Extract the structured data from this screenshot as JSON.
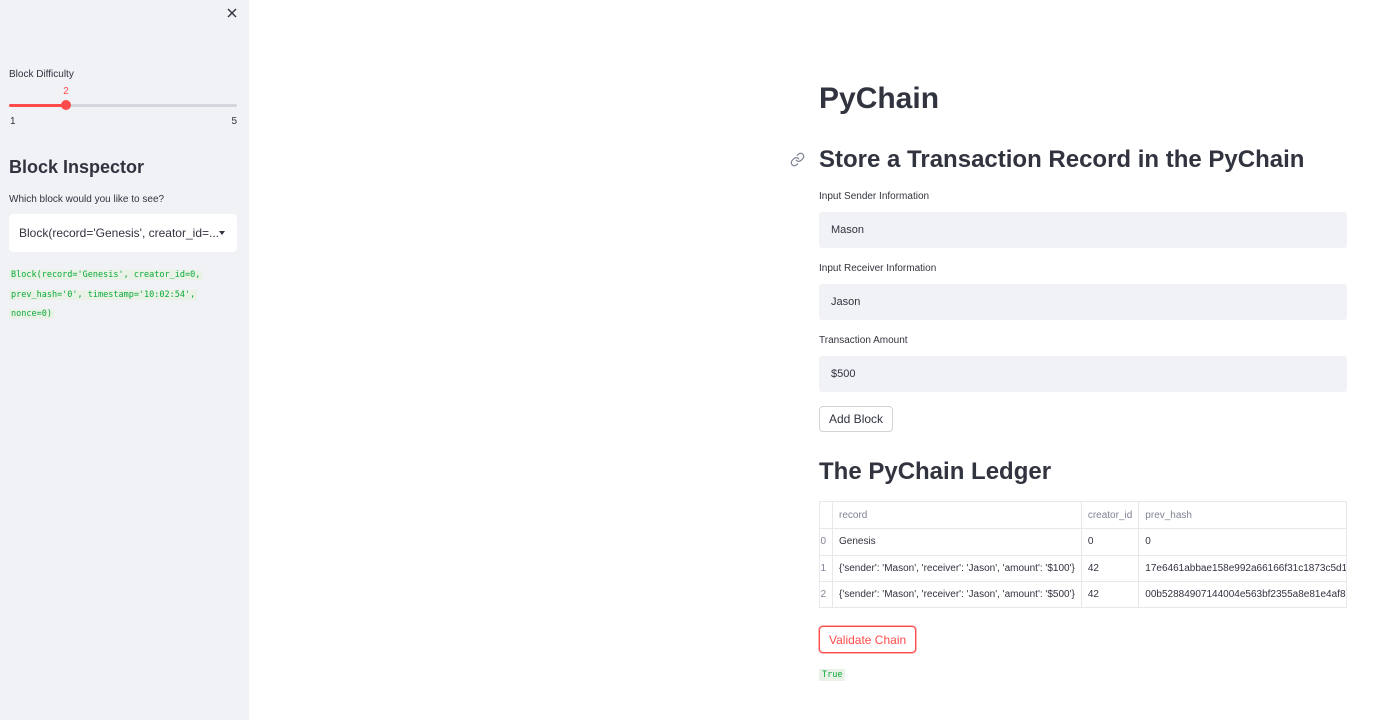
{
  "sidebar": {
    "difficulty_label": "Block Difficulty",
    "difficulty": {
      "value": "2",
      "min": "1",
      "max": "5",
      "fraction": 0.25
    },
    "inspector_title": "Block Inspector",
    "select_label": "Which block would you like to see?",
    "select_value": "Block(record='Genesis', creator_id=...",
    "block_output": [
      "Block(record='Genesis', creator_id=0,",
      "prev_hash='0', timestamp='10:02:54',",
      "nonce=0)"
    ]
  },
  "main": {
    "title": "PyChain",
    "store_heading": "Store a Transaction Record in the PyChain",
    "sender_label": "Input Sender Information",
    "sender_value": "Mason",
    "receiver_label": "Input Receiver Information",
    "receiver_value": "Jason",
    "amount_label": "Transaction Amount",
    "amount_value": "$500",
    "add_block_label": "Add Block",
    "ledger_heading": "The PyChain Ledger",
    "ledger": {
      "columns": [
        "",
        "record",
        "creator_id",
        "prev_hash"
      ],
      "rows": [
        [
          "0",
          "Genesis",
          "0",
          "0"
        ],
        [
          "1",
          "{'sender': 'Mason', 'receiver': 'Jason', 'amount': '$100'}",
          "42",
          "17e6461abbae158e992a66166f31c1873c5d1"
        ],
        [
          "2",
          "{'sender': 'Mason', 'receiver': 'Jason', 'amount': '$500'}",
          "42",
          "00b52884907144004e563bf2355a8e81e4af8"
        ]
      ]
    },
    "validate_label": "Validate Chain",
    "validate_result": "True"
  },
  "colors": {
    "accent": "#ff4b4b",
    "sidebar_bg": "#f0f2f6",
    "code_green": "#09ab3b"
  },
  "icons": [
    "close-icon",
    "link-icon",
    "chevron-down-icon"
  ]
}
